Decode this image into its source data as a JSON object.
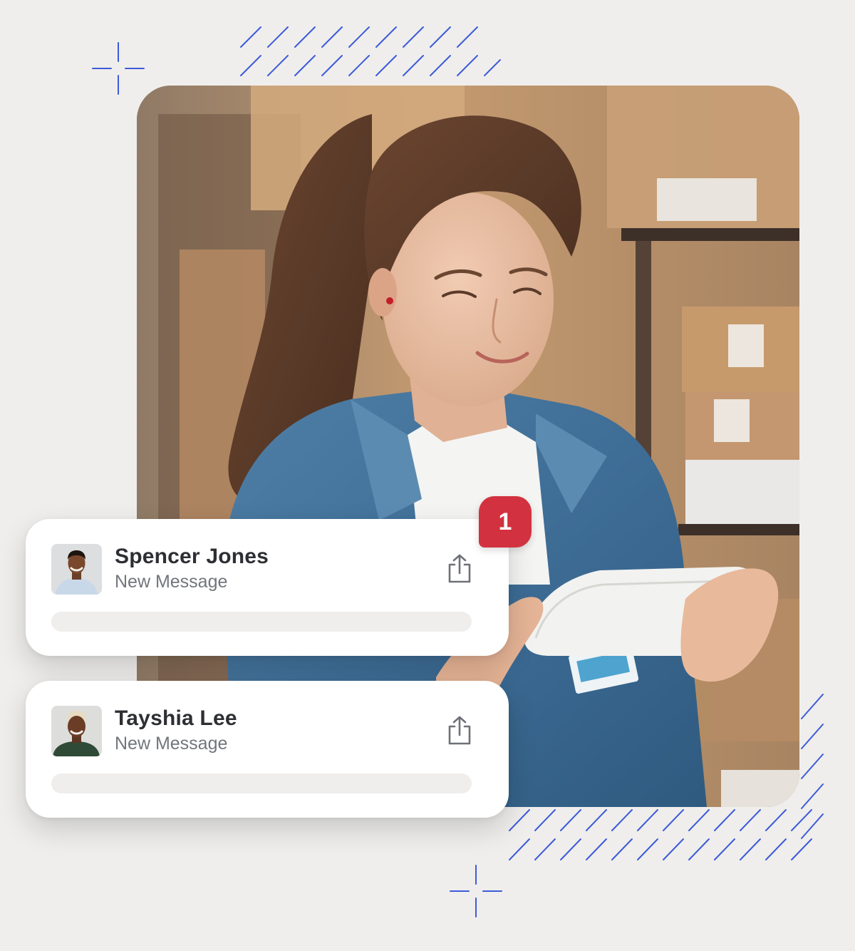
{
  "notifications": [
    {
      "name": "Spencer Jones",
      "subtitle": "New Message",
      "avatar": "man-portrait-avatar",
      "action_icon": "share-icon"
    },
    {
      "name": "Tayshia Lee",
      "subtitle": "New Message",
      "avatar": "woman-portrait-avatar",
      "action_icon": "share-icon"
    }
  ],
  "badge": {
    "count": "1",
    "color": "#d2323f"
  },
  "photo": {
    "subject": "woman-using-tablet-photo"
  },
  "colors": {
    "background": "#efeeec",
    "accent_lines": "#3d5bd9",
    "card": "#ffffff",
    "name_text": "#2d2f33",
    "subtitle_text": "#72767c"
  }
}
